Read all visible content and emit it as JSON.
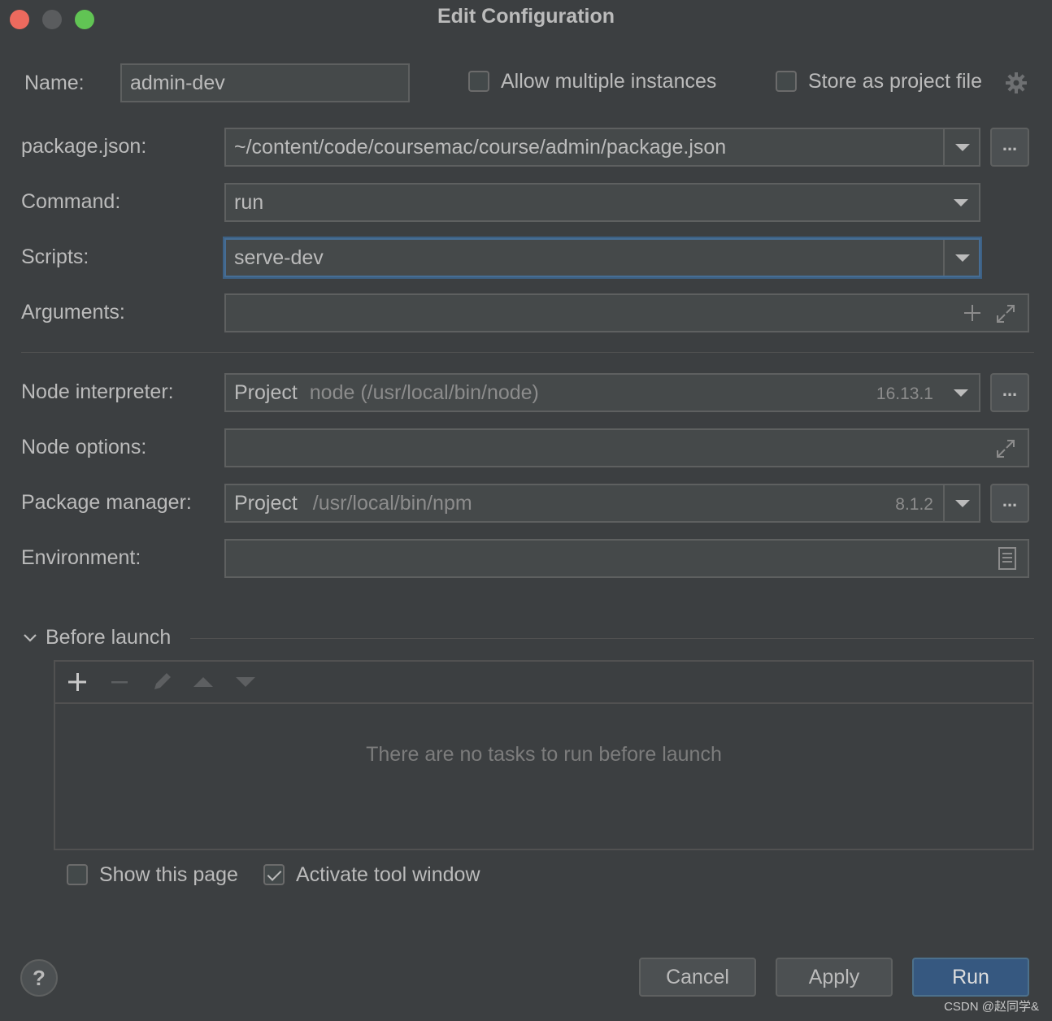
{
  "window": {
    "title": "Edit Configuration"
  },
  "name": {
    "label": "Name:",
    "value": "admin-dev"
  },
  "options": {
    "allow_multiple": "Allow multiple instances",
    "store_as_project": "Store as project file"
  },
  "package_json": {
    "label": "package.json:",
    "value": "~/content/code/coursemac/course/admin/package.json",
    "browse": "..."
  },
  "command": {
    "label": "Command:",
    "value": "run"
  },
  "scripts": {
    "label": "Scripts:",
    "value": "serve-dev"
  },
  "arguments": {
    "label": "Arguments:",
    "value": ""
  },
  "node_interpreter": {
    "label": "Node interpreter:",
    "prefix": "Project",
    "path": "node (/usr/local/bin/node)",
    "version": "16.13.1",
    "browse": "..."
  },
  "node_options": {
    "label": "Node options:",
    "value": ""
  },
  "package_manager": {
    "label": "Package manager:",
    "prefix": "Project",
    "path": "/usr/local/bin/npm",
    "version": "8.1.2",
    "browse": "..."
  },
  "environment": {
    "label": "Environment:",
    "value": ""
  },
  "before_launch": {
    "label": "Before launch",
    "empty_message": "There are no tasks to run before launch",
    "show_page": {
      "label": "Show this page",
      "checked": false
    },
    "activate_tool_window": {
      "label": "Activate tool window",
      "checked": true
    }
  },
  "buttons": {
    "help": "?",
    "cancel": "Cancel",
    "apply": "Apply",
    "run": "Run"
  },
  "watermark": "CSDN @赵同学&",
  "colors": {
    "background": "#3c3f41",
    "field": "#45494a",
    "primary_button": "#365880",
    "focus": "#466d94"
  }
}
